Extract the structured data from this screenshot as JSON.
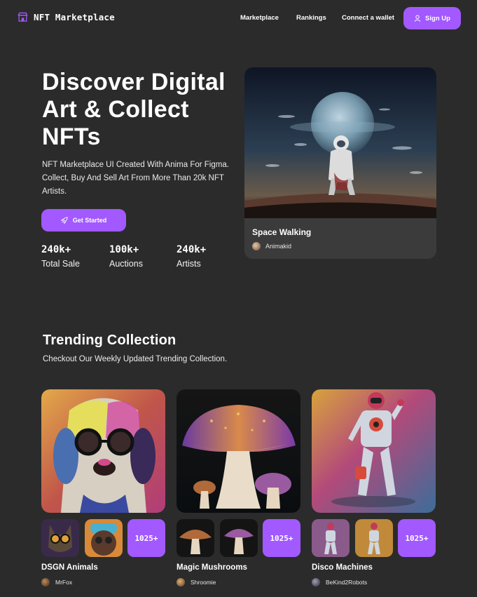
{
  "nav": {
    "brand": "NFT Marketplace",
    "brand_icon": "storefront-icon",
    "links": [
      "Marketplace",
      "Rankings",
      "Connect a wallet"
    ],
    "signup_label": "Sign Up",
    "signup_icon": "user-icon"
  },
  "hero": {
    "title": "Discover Digital Art & Collect NFTs",
    "subtitle": "NFT Marketplace UI Created With Anima For Figma. Collect, Buy And Sell Art From More Than 20k NFT Artists.",
    "cta_label": "Get Started",
    "cta_icon": "rocket-icon",
    "stats": [
      {
        "value": "240k+",
        "label": "Total Sale"
      },
      {
        "value": "100k+",
        "label": "Auctions"
      },
      {
        "value": "240k+",
        "label": "Artists"
      }
    ]
  },
  "featured": {
    "name": "Space Walking",
    "artist": "Animakid"
  },
  "trending": {
    "title": "Trending Collection",
    "subtitle": "Checkout Our Weekly Updated Trending Collection.",
    "collections": [
      {
        "name": "DSGN Animals",
        "artist": "MrFox",
        "count": "1025+"
      },
      {
        "name": "Magic Mushrooms",
        "artist": "Shroomie",
        "count": "1025+"
      },
      {
        "name": "Disco Machines",
        "artist": "BeKind2Robots",
        "count": "1025+"
      }
    ]
  },
  "colors": {
    "background": "#2b2b2b",
    "card": "#3b3b3b",
    "accent": "#a259ff",
    "text": "#ffffff"
  }
}
